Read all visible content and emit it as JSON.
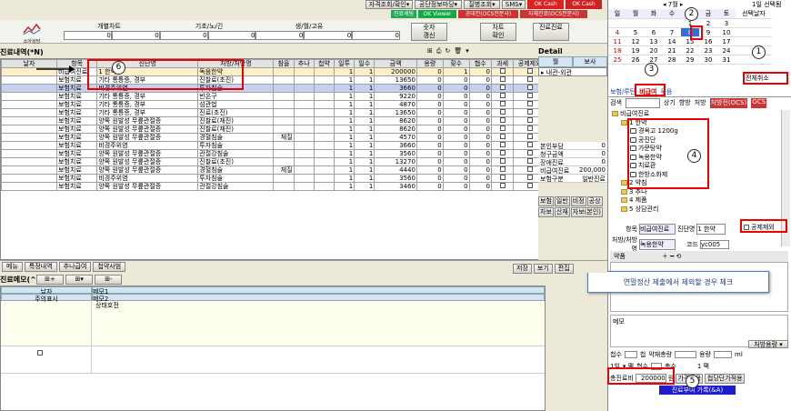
{
  "top_buttons": [
    "자격조회/확인▾",
    "공단정보마당▾",
    "질병조회▾",
    "SMS▾"
  ],
  "top_badges": [
    "OK Cash",
    "OK Cash"
  ],
  "top_buttons2": [
    "진료세팅",
    "OK Viewer",
    "공대전(OCS전문사)",
    "자체진료(OCS전문사)"
  ],
  "calendar": {
    "nav": "◂ 7월 ▸",
    "right_label": "1일 선택됨",
    "weekdays": [
      "일",
      "월",
      "화",
      "수",
      "목",
      "금",
      "토"
    ],
    "sel_header": "선택날자",
    "rows": [
      [
        "",
        "",
        "",
        "",
        "1",
        "2",
        "3"
      ],
      [
        "4",
        "5",
        "6",
        "7",
        "8",
        "9",
        "10"
      ],
      [
        "11",
        "12",
        "13",
        "14",
        "15",
        "16",
        "17"
      ],
      [
        "18",
        "19",
        "20",
        "21",
        "22",
        "23",
        "24"
      ],
      [
        "25",
        "26",
        "27",
        "28",
        "29",
        "30",
        "31"
      ]
    ],
    "selected": "8",
    "reset_btn": "전체취소"
  },
  "toolbar": {
    "logo_label": "소아상담",
    "chart": "개별차트",
    "basic": "기초/노/긴",
    "month": "생/월/고유",
    "btn_sunja": "숫자\n갱신",
    "btn_chart": "차트\n확인",
    "btn_prev": "진료진료"
  },
  "left_title": "진료내역(*N)",
  "table": {
    "headers": [
      "날자",
      "항목",
      "진단명",
      "처방/처방명",
      "참을",
      "추나",
      "첩약",
      "일투",
      "일수",
      "금액",
      "용량",
      "횟수",
      "협수",
      "과세",
      "공제제외"
    ],
    "rows": [
      [
        "",
        "비급여진료",
        "1 한약",
        "독음한약",
        "",
        "",
        "",
        "1",
        "1",
        "200000",
        "0",
        "1",
        "0",
        "",
        ""
      ],
      [
        "",
        "보험치료",
        "기타 통틍증, 경부",
        "진찰료(초진)",
        "",
        "",
        "",
        "1",
        "1",
        "13650",
        "0",
        "0",
        "0",
        "",
        ""
      ],
      [
        "",
        "보험치료",
        "비경주위염",
        "투자침술",
        "",
        "",
        "",
        "1",
        "1",
        "3660",
        "0",
        "0",
        "0",
        "",
        ""
      ],
      [
        "",
        "보험치료",
        "기타 통틍증, 경부",
        "반온구",
        "",
        "",
        "",
        "1",
        "1",
        "9220",
        "0",
        "0",
        "0",
        "",
        ""
      ],
      [
        "",
        "보험치료",
        "기타 통틍증, 경부",
        "섬관법",
        "",
        "",
        "",
        "1",
        "1",
        "4870",
        "0",
        "0",
        "0",
        "",
        ""
      ],
      [
        "",
        "보험치료",
        "기타 통틍증, 경부",
        "진료(초진)",
        "",
        "",
        "",
        "1",
        "1",
        "13650",
        "0",
        "0",
        "0",
        "",
        ""
      ],
      [
        "",
        "보험치료",
        "양쪽 원발성 무릎관절증",
        "진찰료(재진)",
        "",
        "",
        "",
        "1",
        "1",
        "8620",
        "0",
        "0",
        "0",
        "",
        ""
      ],
      [
        "",
        "보험치료",
        "양쪽 원발성 무릎관절증",
        "진찰료(재진)",
        "",
        "",
        "",
        "1",
        "1",
        "8620",
        "0",
        "0",
        "0",
        "",
        ""
      ],
      [
        "",
        "보험치료",
        "양쪽 원발성 무릎관절증",
        "경혈침술",
        "체질",
        "",
        "",
        "1",
        "1",
        "4570",
        "0",
        "0",
        "0",
        "",
        ""
      ],
      [
        "",
        "보험치료",
        "비경주위염",
        "투자침술",
        "",
        "",
        "",
        "1",
        "1",
        "3660",
        "0",
        "0",
        "0",
        "",
        ""
      ],
      [
        "",
        "보험치료",
        "양쪽 원발성 무릎관절증",
        "관절강침술",
        "",
        "",
        "",
        "1",
        "1",
        "3560",
        "0",
        "0",
        "0",
        "",
        ""
      ],
      [
        "",
        "보험치료",
        "양쪽 원발성 무릎관절증",
        "진찰료(초진)",
        "",
        "",
        "",
        "1",
        "1",
        "13270",
        "0",
        "0",
        "0",
        "",
        ""
      ],
      [
        "",
        "보험치료",
        "양쪽 원발성 무릎관절증",
        "경혈침술",
        "체질",
        "",
        "",
        "1",
        "1",
        "4440",
        "0",
        "0",
        "0",
        "",
        ""
      ],
      [
        "",
        "보험치료",
        "비경주위염",
        "투자침술",
        "",
        "",
        "",
        "1",
        "1",
        "3560",
        "0",
        "0",
        "0",
        "",
        ""
      ],
      [
        "",
        "보험치료",
        "양쪽 원발성 무릎관절증",
        "관절강침술",
        "",
        "",
        "",
        "1",
        "1",
        "3460",
        "0",
        "0",
        "0",
        "",
        ""
      ]
    ]
  },
  "detail": {
    "title": "Detail",
    "h1": "월",
    "h2": "보사",
    "row": "내관-외관",
    "summary": [
      [
        "본인부담",
        "0"
      ],
      [
        "청구금액",
        "0"
      ],
      [
        "장애진료",
        "0"
      ],
      [
        "비급여진료",
        "200,000"
      ],
      [
        "보험구분",
        "일반진료"
      ]
    ],
    "btns1": [
      "보험",
      "일반",
      "비정",
      "공상"
    ],
    "btns2": [
      "자보",
      "산재",
      "자보(본인)"
    ]
  },
  "right": {
    "tabs": [
      "보험/루틴",
      "비급여",
      "묶음"
    ],
    "row2": [
      "검색",
      "",
      "상기",
      "향방",
      "처방"
    ],
    "tags": [
      "처방전(OCS)",
      "OCS"
    ],
    "tree": [
      {
        "t": "비급여진료",
        "lvl": 0,
        "k": "folder"
      },
      {
        "t": "1 한약",
        "lvl": 1,
        "k": "folder"
      },
      {
        "t": "경옥고 1200g",
        "lvl": 2,
        "k": "leaf"
      },
      {
        "t": "공진단",
        "lvl": 2,
        "k": "leaf"
      },
      {
        "t": "가문탕약",
        "lvl": 2,
        "k": "leaf"
      },
      {
        "t": "녹용한약",
        "lvl": 2,
        "k": "leaf"
      },
      {
        "t": "치료환",
        "lvl": 2,
        "k": "leaf"
      },
      {
        "t": "한방소화제",
        "lvl": 2,
        "k": "leaf"
      },
      {
        "t": "2 약침",
        "lvl": 1,
        "k": "folder"
      },
      {
        "t": "3 추나",
        "lvl": 1,
        "k": "folder"
      },
      {
        "t": "4 제품",
        "lvl": 1,
        "k": "folder"
      },
      {
        "t": "5 상담관리",
        "lvl": 1,
        "k": "folder"
      }
    ],
    "field_label1": "항목",
    "field_val1": "비급여진료",
    "field_label2": "진단명",
    "field_val2": "1 한약",
    "field_label3": "처방/처방명",
    "field_val3": "녹용한약",
    "field_label4": "코드",
    "field_val4": "yc005",
    "gongje": "공제제외",
    "yak": "약품",
    "memo": "메모",
    "callout": "연말정산 제출에서 제외할 경우 체크",
    "dose_btn": "처방용량 ▾",
    "dose_lbl1": "첩수",
    "dose_lbl2": "첩",
    "dose_lbl3": "약재총량",
    "dose_lbl4": "용량",
    "dose_unit": "ml",
    "row_a": "1일",
    "row_b": "▾ 팩",
    "row_c": "협수",
    "row_d": "1 팩",
    "row_e": "총수",
    "price_lbl": "총진료비",
    "price_val": "200000",
    "price_unit": "원",
    "btn_price": "가격적용",
    "btn_daily": "첩당단가적용",
    "save_btn": "진료부여 가록(&A)"
  },
  "bottom": {
    "tabs": [
      "메뉴",
      "특정내역",
      "추나급여",
      "첩약사범"
    ],
    "memo_title": "진료메모(^F)",
    "memo_h1": "날자",
    "memo_h2": "메모1",
    "memo_h3": "주의표시",
    "memo_h4": "메모2",
    "memo_line": "상태호전",
    "mini_btns": [
      "저장",
      "보기",
      "편집"
    ]
  },
  "annotations": [
    "1",
    "2",
    "3",
    "4",
    "5",
    "6"
  ]
}
